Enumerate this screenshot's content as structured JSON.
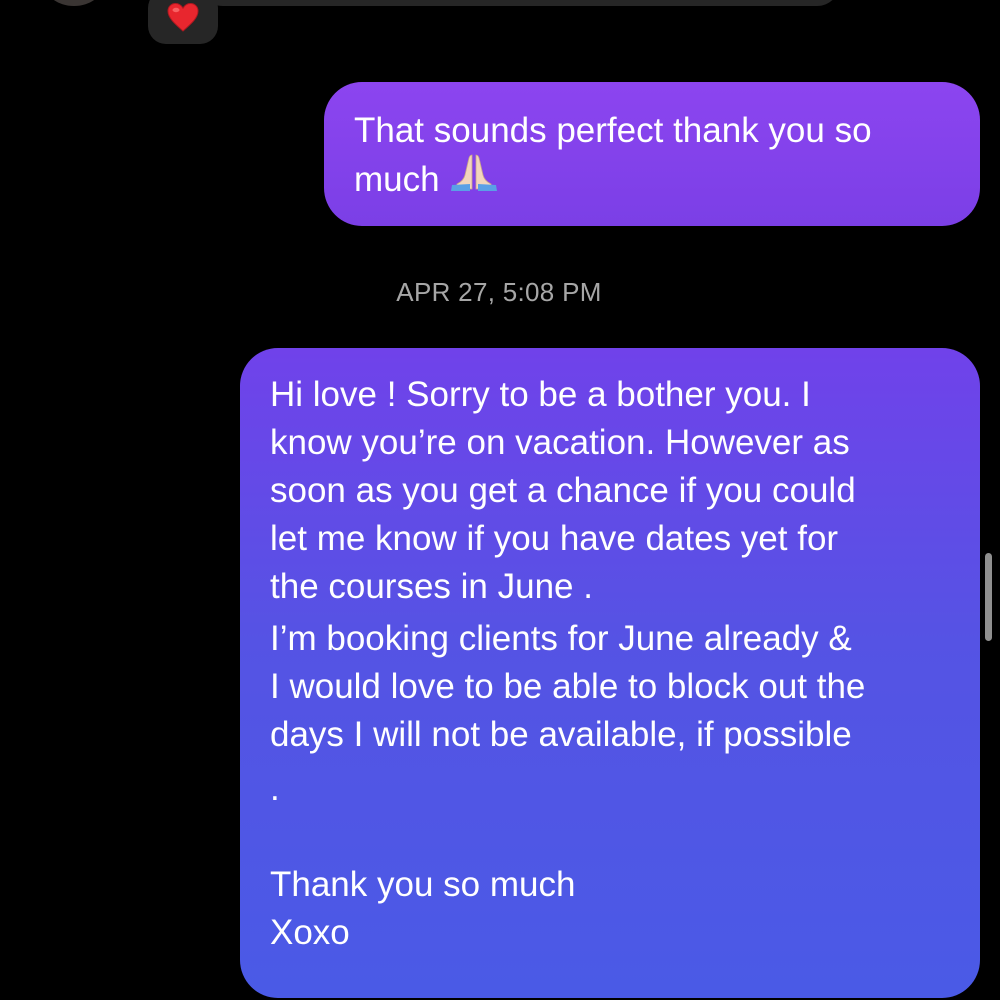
{
  "previous_message": {
    "reaction": "heart-emoji"
  },
  "message_1": {
    "lines": [
      "That sounds perfect thank you so",
      "much"
    ],
    "emoji": "folded-hands-emoji"
  },
  "timestamp": "APR 27, 5:08 PM",
  "message_2": {
    "paragraph_1": [
      "Hi love ! Sorry to be a bother you. I",
      "know you’re on vacation. However as",
      "soon as you get a chance if you could",
      "let me know if you have dates yet for",
      "the courses in June ."
    ],
    "paragraph_2": [
      "I’m booking clients for June already &",
      "I would love to be able to block out the",
      "days I will not be available, if possible",
      "."
    ],
    "closing": [
      "Thank you so much",
      "Xoxo"
    ]
  },
  "colors": {
    "background": "#000000",
    "bubble_1": "#8c45f0",
    "bubble_2_top": "#7042ea",
    "bubble_2_bottom": "#4a5ae6",
    "timestamp": "#a6a6a6",
    "incoming_bubble": "#262626"
  }
}
